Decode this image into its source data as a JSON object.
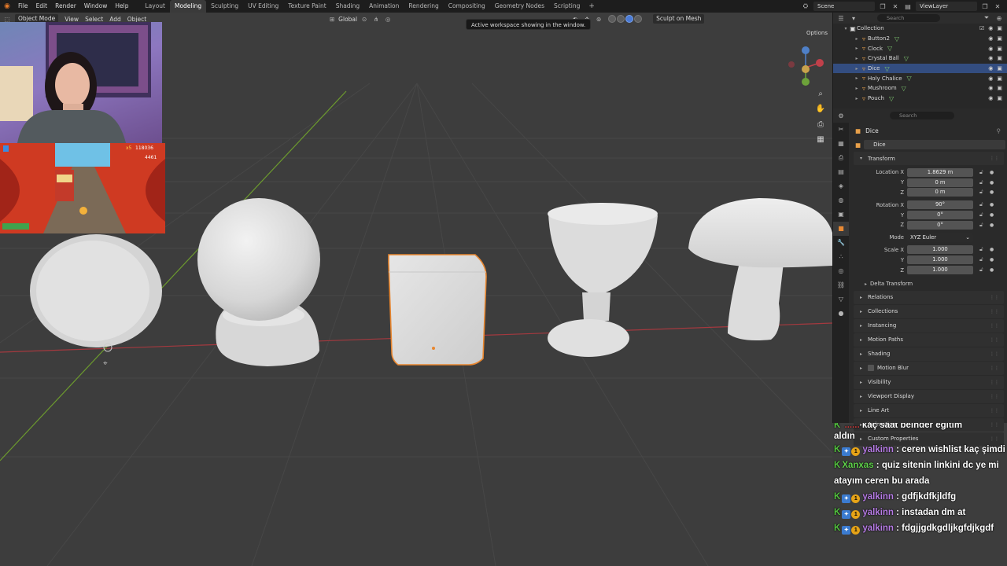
{
  "topbar": {
    "menus": [
      "File",
      "Edit",
      "Render",
      "Window",
      "Help"
    ],
    "workspaces": [
      "Layout",
      "Modeling",
      "Sculpting",
      "UV Editing",
      "Texture Paint",
      "Shading",
      "Animation",
      "Rendering",
      "Compositing",
      "Geometry Nodes",
      "Scripting"
    ],
    "active_workspace": "Modeling",
    "plus": "+",
    "scene": "Scene",
    "view_layer": "ViewLayer"
  },
  "viewport": {
    "mode": "Object Mode",
    "menus": [
      "View",
      "Select",
      "Add",
      "Object"
    ],
    "orientation": "Global",
    "tooltip": "Active workspace showing in the window.",
    "sculpt_button": "Sculpt on Mesh",
    "options": "Options"
  },
  "overlays": {
    "game_score": "118036",
    "game_coins": "4461",
    "game_multiplier": "x5"
  },
  "outliner": {
    "search_placeholder": "Search",
    "collection": "Collection",
    "items": [
      {
        "name": "Button2",
        "selected": false
      },
      {
        "name": "Clock",
        "selected": false
      },
      {
        "name": "Crystal Ball",
        "selected": false
      },
      {
        "name": "Dice",
        "selected": true
      },
      {
        "name": "Holy Chalice",
        "selected": false
      },
      {
        "name": "Mushroom",
        "selected": false
      },
      {
        "name": "Pouch",
        "selected": false
      }
    ]
  },
  "properties": {
    "search_placeholder": "Search",
    "object_name": "Dice",
    "object_field": "Dice",
    "transform_title": "Transform",
    "location_label": "Location X",
    "location": [
      "1.8629 m",
      "0 m",
      "0 m"
    ],
    "rotation_label": "Rotation X",
    "rotation": [
      "90°",
      "0°",
      "0°"
    ],
    "mode_label": "Mode",
    "mode_value": "XYZ Euler",
    "scale_label": "Scale X",
    "scale": [
      "1.000",
      "1.000",
      "1.000"
    ],
    "axis_y": "Y",
    "axis_z": "Z",
    "delta_transform": "Delta Transform",
    "panels": [
      "Relations",
      "Collections",
      "Instancing",
      "Motion Paths",
      "Shading",
      "Motion Blur",
      "Visibility",
      "Viewport Display",
      "Line Art",
      "Animation",
      "Custom Properties"
    ]
  },
  "chat": {
    "partial_text": "kaç saat belnder eğitim",
    "partial_tail": "aldın",
    "messages": [
      {
        "user": "yalkinn",
        "text": ": ceren wishlist kaç şimdi",
        "badges": true,
        "color": "yalkin"
      },
      {
        "user": "Xanxas",
        "text": ": quiz sitenin linkini dc ye mi atayım ceren bu arada",
        "badges": false,
        "color": "xanxas"
      },
      {
        "user": "yalkinn",
        "text": ": gdfjkdfkjldfg",
        "badges": true,
        "color": "yalkin"
      },
      {
        "user": "yalkinn",
        "text": ": instadan dm at",
        "badges": true,
        "color": "yalkin"
      },
      {
        "user": "yalkinn",
        "text": ": fdgjjgdkgdljkgfdjkgdf",
        "badges": true,
        "color": "yalkin"
      }
    ]
  },
  "colors": {
    "selection_outline": "#e8862f",
    "x_axis": "#a4393f",
    "y_axis": "#6c9a2e",
    "outliner_selected": "#334d80",
    "accent_blue": "#4b7bd6"
  }
}
